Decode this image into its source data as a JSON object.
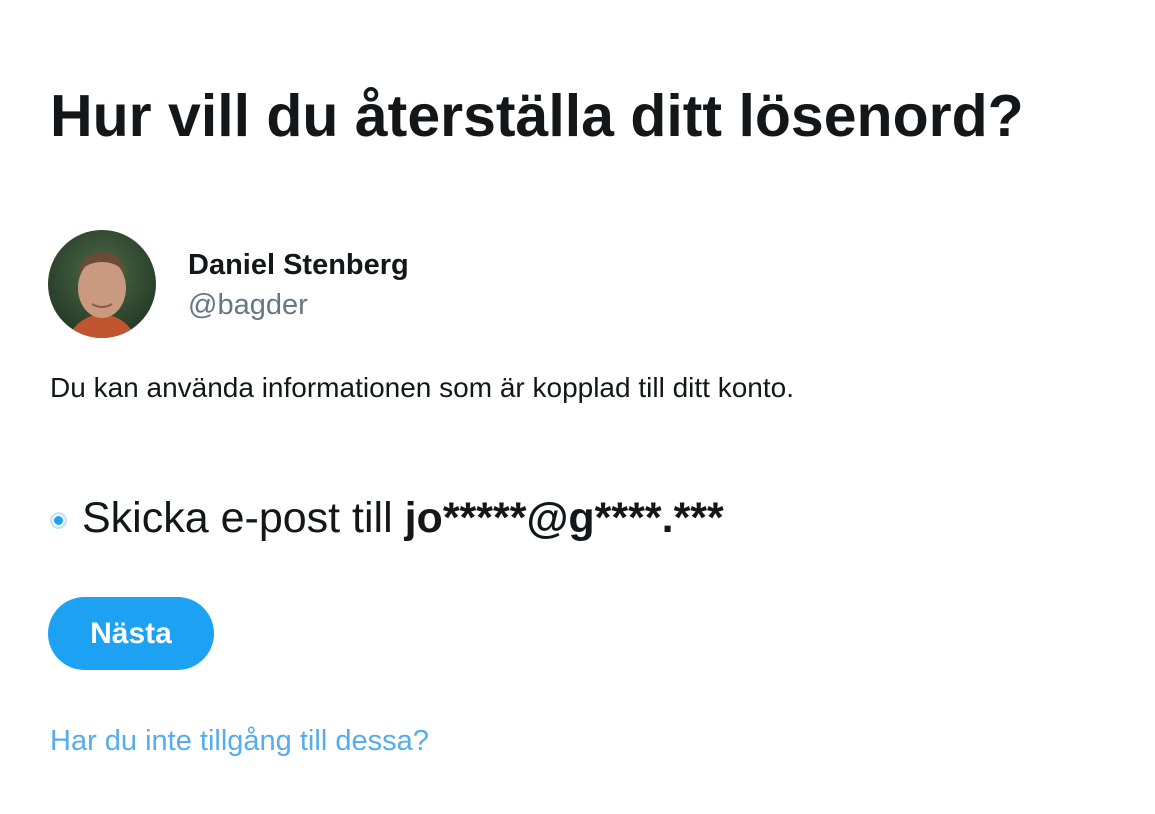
{
  "page": {
    "title": "Hur vill du återställa ditt lösenord?"
  },
  "account": {
    "name": "Daniel Stenberg",
    "handle": "@bagder"
  },
  "description": "Du kan använda informationen som är kopplad till ditt konto.",
  "option": {
    "label_prefix": "Skicka e-post till ",
    "masked_email": "jo*****@g****.***",
    "selected": true
  },
  "buttons": {
    "next": "Nästa"
  },
  "links": {
    "no_access": "Har du inte tillgång till dessa?"
  },
  "colors": {
    "accent": "#1da1f2",
    "link": "#55acee",
    "muted": "#657786"
  }
}
